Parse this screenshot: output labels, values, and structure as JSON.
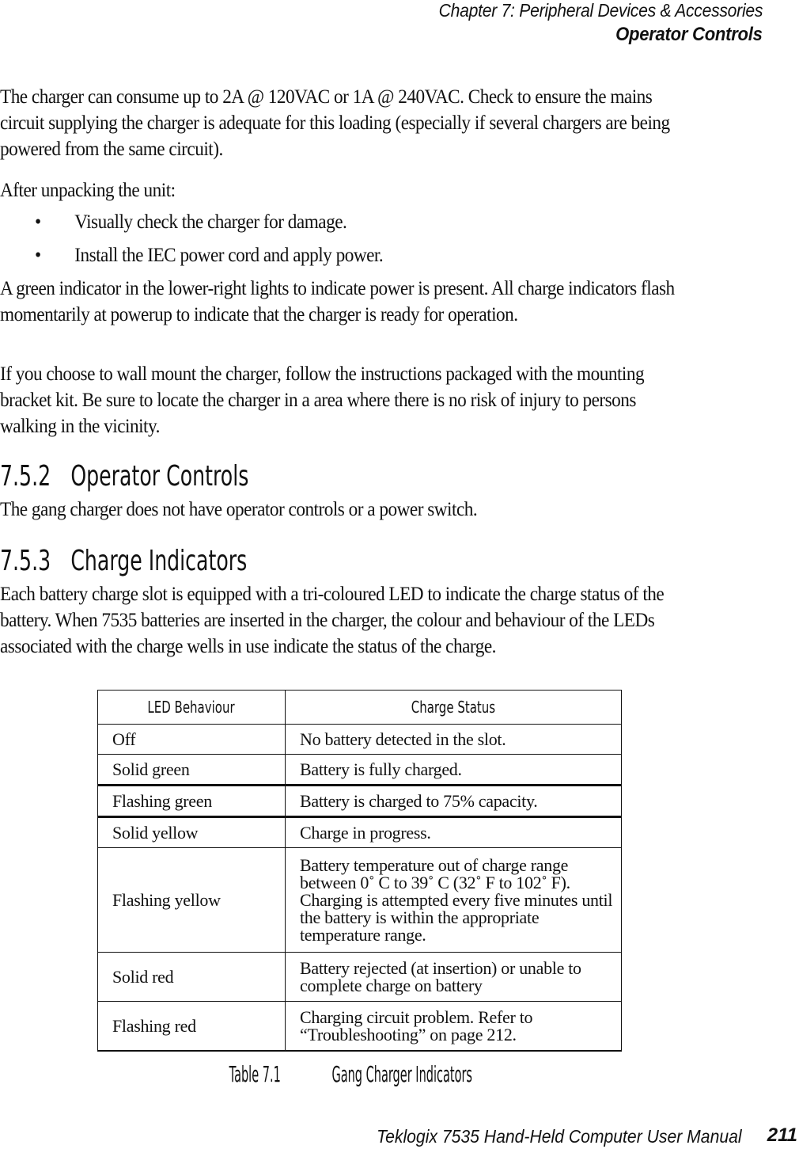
{
  "header": {
    "chapter": "Chapter  7:  Peripheral Devices & Accessories",
    "section": "Operator Controls"
  },
  "paragraphs": {
    "power_consumption": "The charger can consume up to 2A @ 120VAC or 1A @ 240VAC.   Check to ensure the mains circuit supplying the charger is adequate for this loading (especially if several chargers are being powered from the same circuit).",
    "after_unpacking": "After unpacking the unit:",
    "bullets": [
      "Visually check the charger for damage.",
      "Install the IEC power cord and apply power."
    ],
    "green_indicator": "A green indicator in the lower-right lights to indicate power is present. All charge indicators flash momentarily at powerup to indicate that the charger is ready for operation.",
    "wall_mount": "If you choose to wall mount the charger, follow the instructions packaged with the mounting bracket kit. Be sure to locate the charger in a area where there is no risk of injury to persons walking in the vicinity."
  },
  "sections": [
    {
      "number": "7.5.2",
      "title": "Operator Controls",
      "body": "The gang charger does not have operator controls or a power switch."
    },
    {
      "number": "7.5.3",
      "title": "Charge Indicators",
      "body": "Each battery charge slot is equipped with a tri-coloured LED to indicate the charge status of the battery. When 7535 batteries are inserted in the charger, the colour and behaviour of the LEDs associated with the charge wells in use indicate the status of the charge."
    }
  ],
  "table": {
    "headers": [
      "LED Behaviour",
      "Charge Status"
    ],
    "rows": [
      [
        "Off",
        "No battery detected in the slot."
      ],
      [
        "Solid green",
        "Battery is fully charged."
      ],
      [
        "Flashing green",
        "Battery is charged to 75% capacity."
      ],
      [
        "Solid yellow",
        "Charge in progress."
      ],
      [
        "Flashing yellow",
        "Battery temperature out of charge range between 0˚ C to 39˚ C (32˚ F to 102˚ F). Charging is attempted every five minutes until the battery is within the appropriate temperature range."
      ],
      [
        "Solid red",
        "Battery rejected (at insertion) or unable to complete charge on battery"
      ],
      [
        "Flashing red",
        "Charging circuit problem. Refer to “Troubleshooting” on page 212."
      ]
    ],
    "caption_number": "Table 7.1",
    "caption_title": "Gang Charger Indicators"
  },
  "footer": {
    "manual_title": "Teklogix 7535 Hand-Held Computer User Manual",
    "page_number": "211"
  }
}
